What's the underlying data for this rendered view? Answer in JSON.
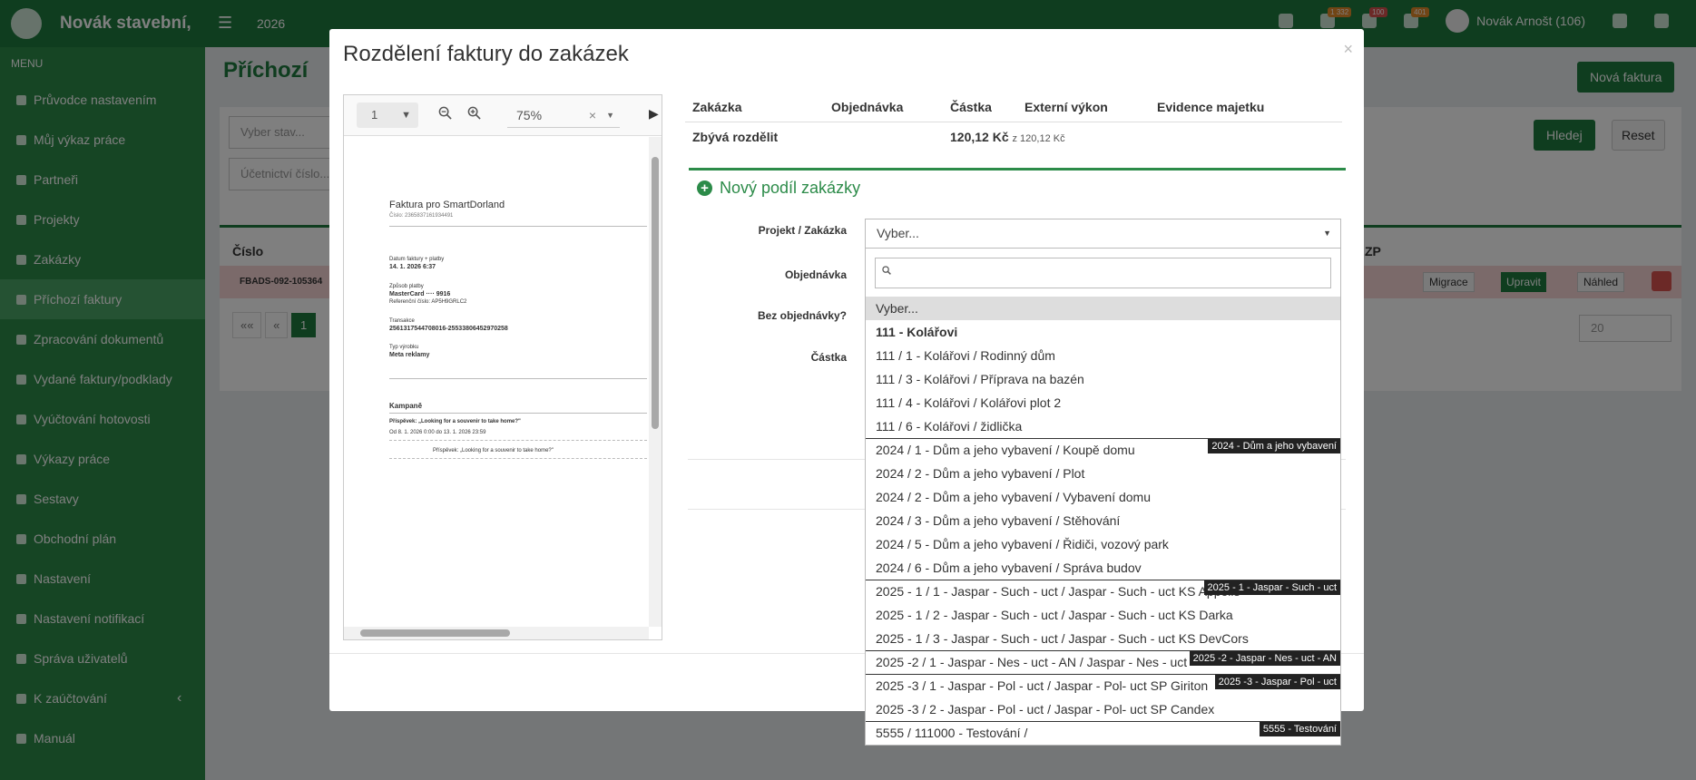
{
  "app": {
    "brand": "Novák stavební,",
    "year": "2026",
    "badges": [
      "1 332",
      "100",
      "401"
    ],
    "user": "Novák Arnošt (106)"
  },
  "sidebar": {
    "heading": "MENU",
    "items": [
      {
        "label": "Průvodce nastavením",
        "icon": "pencil-icon"
      },
      {
        "label": "Můj výkaz práce",
        "icon": "clock-icon"
      },
      {
        "label": "Partneři",
        "icon": "building-icon"
      },
      {
        "label": "Projekty",
        "icon": "cubes-icon"
      },
      {
        "label": "Zakázky",
        "icon": "cube-icon"
      },
      {
        "label": "Příchozí faktury",
        "icon": "file-icon"
      },
      {
        "label": "Zpracování dokumentů",
        "icon": "file-icon"
      },
      {
        "label": "Vydané faktury/podklady",
        "icon": "share-icon"
      },
      {
        "label": "Vyúčtování hotovosti",
        "icon": "money-icon"
      },
      {
        "label": "Výkazy práce",
        "icon": "clock-icon"
      },
      {
        "label": "Sestavy",
        "icon": "list-icon"
      },
      {
        "label": "Obchodní plán",
        "icon": "send-icon"
      },
      {
        "label": "Nastavení",
        "icon": "gears-icon"
      },
      {
        "label": "Nastavení notifikací",
        "icon": "bell-icon"
      },
      {
        "label": "Správa uživatelů",
        "icon": "users-icon"
      },
      {
        "label": "K zaúčtování",
        "icon": "folder-icon"
      },
      {
        "label": "Manuál",
        "icon": "book-icon"
      }
    ]
  },
  "page": {
    "title": "Příchozí",
    "new_invoice": "Nová faktura",
    "filter_state_placeholder": "Vyber stav...",
    "filter_number_placeholder": "Účetnictví číslo...",
    "search_label": "Hledej",
    "reset_label": "Reset",
    "table_col_number": "Číslo",
    "table_col_zp": "ZP",
    "row_number": "FBADS-092-105364",
    "row_actions": {
      "migrate": "Migrace",
      "edit": "Upravit",
      "preview": "Náhled"
    },
    "pagination": {
      "first": "««",
      "prev": "«",
      "current": "1"
    },
    "page_size": "20"
  },
  "modal": {
    "title": "Rozdělení faktury do zakázek",
    "close": "×",
    "pdf": {
      "page": "1",
      "zoom": "75%",
      "content": {
        "heading": "Faktura pro SmartDorland",
        "subheading": "Číslo: 2365837161934491",
        "date_label": "Datum faktury + platby",
        "date_value": "14. 1. 2026 6:37",
        "payment_label": "Způsob platby",
        "payment_value": "MasterCard ···· 9916",
        "ref_label": "Referenční číslo: AP5H9GRLC2",
        "txn_label": "Transakce",
        "txn_value": "2561317544708016-25533806452970258",
        "product_label": "Typ výrobku",
        "product_value": "Meta reklamy",
        "campaigns": "Kampaně",
        "campaign_line1": "Příspěvek: „Looking for a souvenir to take home?\"",
        "campaign_line2": "Od 8. 1. 2026 0:00 do 13. 1. 2026 23:59",
        "campaign_line3": "Příspěvek: „Looking for a souvenir to take home?\""
      }
    },
    "table": {
      "headers": [
        "Zakázka",
        "Objednávka",
        "Částka",
        "Externí výkon",
        "Evidence majetku"
      ],
      "remaining_label": "Zbývá rozdělit",
      "remaining_amount": "120,12 Kč",
      "remaining_of": "z 120,12 Kč"
    },
    "new_share": "Nový podíl zakázky",
    "form": {
      "project_label": "Projekt / Zakázka",
      "order_label": "Objednávka",
      "no_order_label": "Bez objednávky?",
      "amount_label": "Částka",
      "select_placeholder": "Vyber..."
    },
    "dropdown": {
      "search_value": "",
      "options": [
        {
          "label": "Vyber...",
          "type": "placeholder"
        },
        {
          "label": "111 - Kolářovi",
          "type": "group"
        },
        {
          "label": "111 / 1 - Kolářovi / Rodinný dům"
        },
        {
          "label": "111 / 3 - Kolářovi / Příprava na bazén"
        },
        {
          "label": "111 / 4 - Kolářovi / Kolářovi plot 2"
        },
        {
          "label": "111 / 6 - Kolářovi / židlička"
        },
        {
          "label": "2024 / 1 - Dům a jeho vybavení / Koupě domu",
          "tag": "2024 - Dům a jeho vybavení"
        },
        {
          "label": "2024 / 2 - Dům a jeho vybavení / Plot"
        },
        {
          "label": "2024 / 2 - Dům a jeho vybavení / Vybavení domu"
        },
        {
          "label": "2024 / 3 - Dům a jeho vybavení / Stěhování"
        },
        {
          "label": "2024 / 5 - Dům a jeho vybavení / Řidiči, vozový park"
        },
        {
          "label": "2024 / 6 - Dům a jeho vybavení / Správa budov"
        },
        {
          "label": "2025 - 1 / 1 - Jaspar - Such - uct / Jaspar - Such - uct KS Appells",
          "tag": "2025 - 1 - Jaspar - Such - uct"
        },
        {
          "label": "2025 - 1 / 2 - Jaspar - Such - uct / Jaspar - Such - uct KS Darka"
        },
        {
          "label": "2025 - 1 / 3 - Jaspar - Such - uct / Jaspar - Such - uct KS DevCors"
        },
        {
          "label": "2025 -2 / 1 - Jaspar - Nes - uct - AN / Jaspar - Nes - uct",
          "tag": "2025 -2 - Jaspar - Nes - uct - AN"
        },
        {
          "label": "2025 -3 / 1 - Jaspar - Pol - uct / Jaspar - Pol- uct SP Giriton",
          "tag": "2025 -3 - Jaspar - Pol - uct"
        },
        {
          "label": "2025 -3 / 2 - Jaspar - Pol - uct / Jaspar - Pol- uct SP Candex"
        },
        {
          "label": "5555 / 111000 - Testování /",
          "tag": "5555 - Testování"
        }
      ]
    }
  }
}
